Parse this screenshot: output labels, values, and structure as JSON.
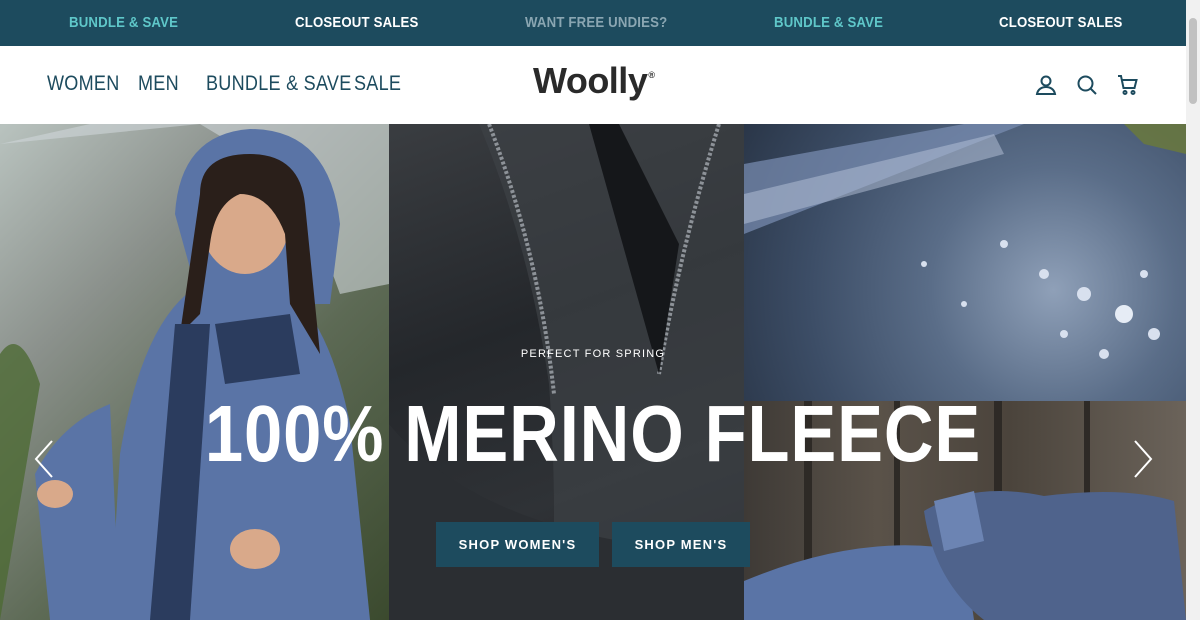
{
  "announcement_bar": {
    "items": [
      {
        "label": "BUNDLE & SAVE",
        "color": "#5fc7c9"
      },
      {
        "label": "CLOSEOUT SALES",
        "color": "#ffffff"
      },
      {
        "label": "WANT FREE UNDIES?",
        "color": "#8aa6b2"
      },
      {
        "label": "BUNDLE & SAVE",
        "color": "#5fc7c9"
      },
      {
        "label": "CLOSEOUT SALES",
        "color": "#ffffff"
      }
    ]
  },
  "header": {
    "nav": [
      {
        "label": "WOMEN"
      },
      {
        "label": "MEN"
      },
      {
        "label": "BUNDLE & SAVE"
      },
      {
        "label": "SALE"
      }
    ],
    "logo": "Woolly",
    "logo_mark": "®",
    "icons": [
      "account-icon",
      "search-icon",
      "cart-icon"
    ]
  },
  "hero": {
    "eyebrow": "PERFECT FOR SPRING",
    "title": "100% MERINO FLEECE",
    "buttons": [
      {
        "label": "SHOP WOMEN'S"
      },
      {
        "label": "SHOP MEN'S"
      }
    ]
  },
  "colors": {
    "brand": "#1d4b5e",
    "accent": "#5fc7c9"
  }
}
